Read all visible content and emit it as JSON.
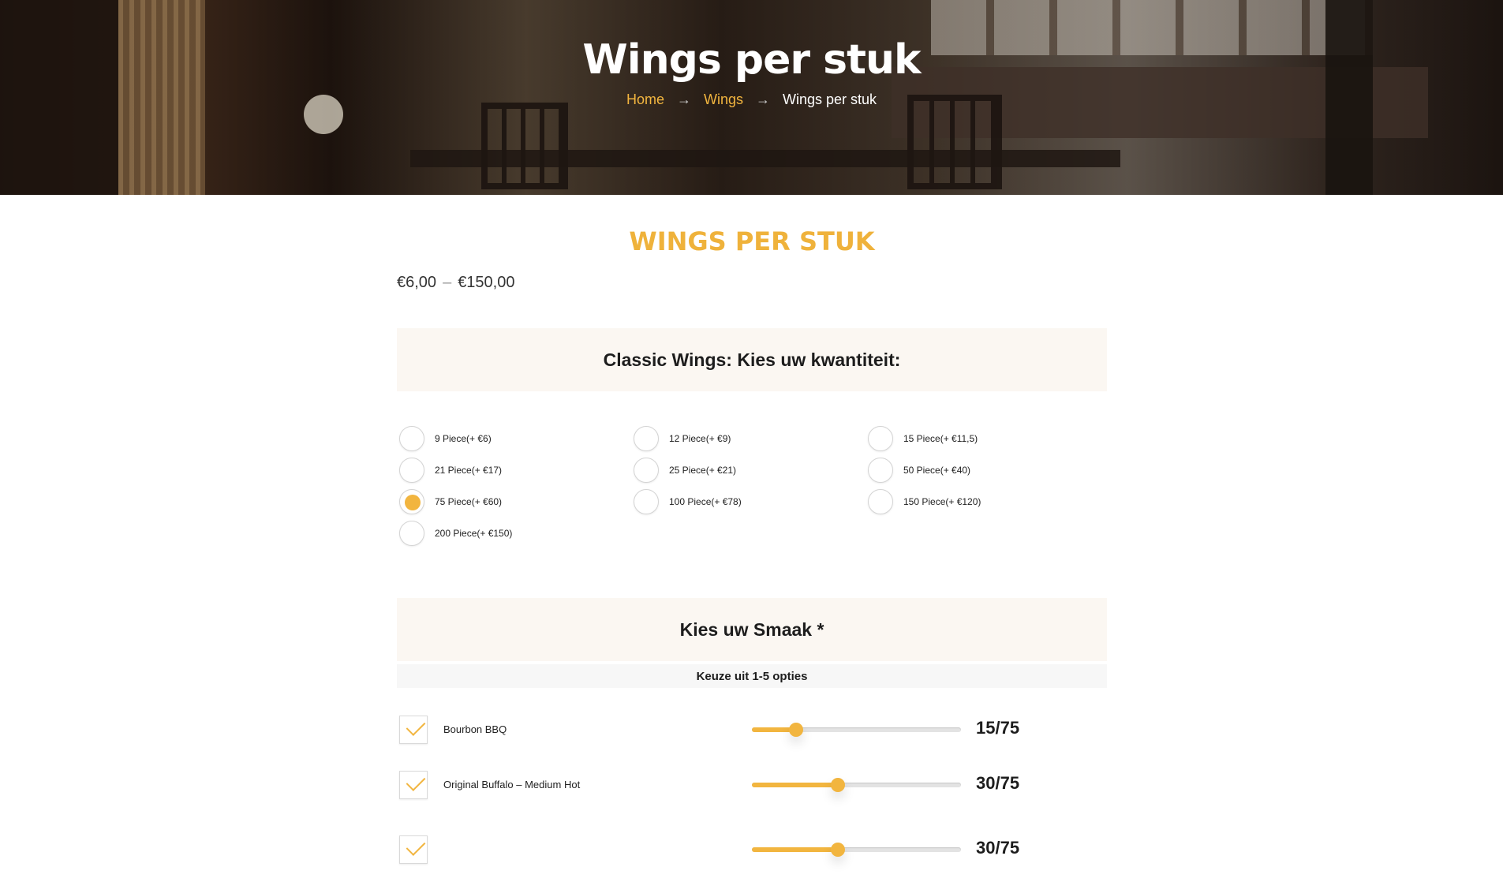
{
  "hero": {
    "title": "Wings per stuk",
    "breadcrumb": {
      "home": "Home",
      "separator": "→",
      "category": "Wings",
      "current": "Wings per stuk"
    }
  },
  "product": {
    "title": "WINGS PER STUK",
    "price_min": "€6,00",
    "price_dash": "–",
    "price_max": "€150,00"
  },
  "quantity_section": {
    "heading": "Classic Wings: Kies uw kwantiteit:",
    "options": [
      {
        "label": "9 Piece(+ €6)",
        "selected": false
      },
      {
        "label": "12 Piece(+ €9)",
        "selected": false
      },
      {
        "label": "15 Piece(+ €11,5)",
        "selected": false
      },
      {
        "label": "21 Piece(+ €17)",
        "selected": false
      },
      {
        "label": "25 Piece(+ €21)",
        "selected": false
      },
      {
        "label": "50 Piece(+ €40)",
        "selected": false
      },
      {
        "label": "75 Piece(+ €60)",
        "selected": true
      },
      {
        "label": "100 Piece(+ €78)",
        "selected": false
      },
      {
        "label": "150 Piece(+ €120)",
        "selected": false
      },
      {
        "label": "200 Piece(+ €150)",
        "selected": false
      }
    ]
  },
  "flavor_section": {
    "heading": "Kies uw Smaak *",
    "subheading": "Keuze uit 1-5 opties",
    "flavors": [
      {
        "label": "Bourbon BBQ",
        "checked": true,
        "value": 15,
        "max": 75,
        "display": "15/75"
      },
      {
        "label": "Original Buffalo – Medium Hot",
        "checked": true,
        "value": 30,
        "max": 75,
        "display": "30/75"
      },
      {
        "label": "",
        "checked": true,
        "value": 30,
        "max": 75,
        "display": "30/75"
      }
    ]
  },
  "colors": {
    "accent": "#f2b53f",
    "section_bg": "#fbf7f2",
    "subhead_bg": "#f7f7f7"
  }
}
